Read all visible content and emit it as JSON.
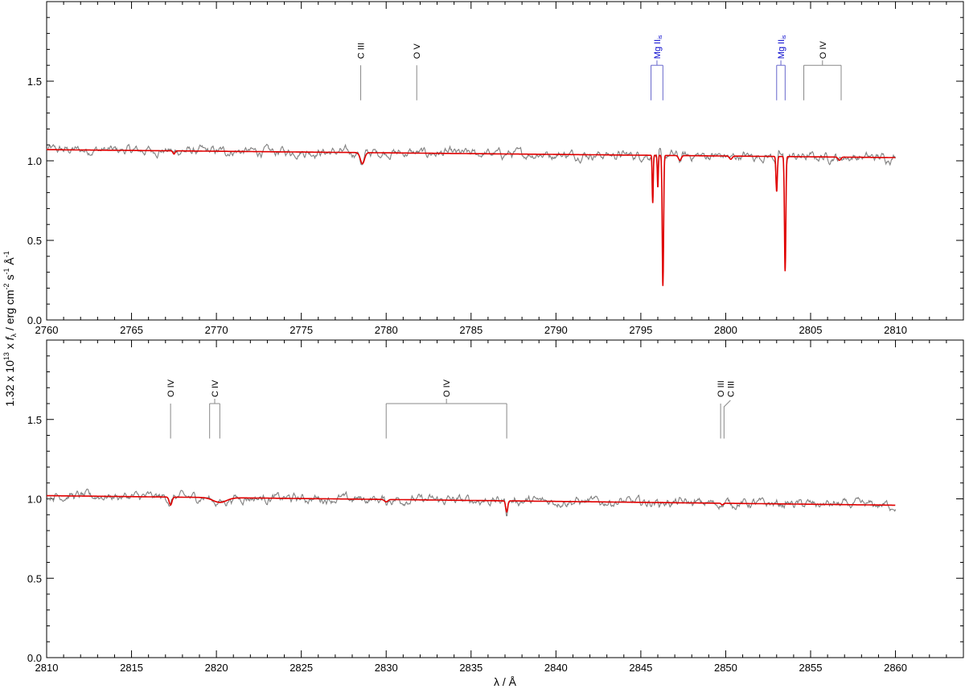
{
  "figure": {
    "ylabel_parts": {
      "prefix": "1.32 x 10",
      "exp": "13",
      "x": " x ",
      "f": "f",
      "lambda_sub": "λ",
      "mid": " / erg cm",
      "cm_exp": "-2",
      "s": " s",
      "s_exp": "-1",
      "A": " Å",
      "A_exp": "-1"
    },
    "xlabel": "λ / Å"
  },
  "chart_data": [
    {
      "type": "line",
      "name": "panel-top",
      "title": "",
      "xlim": [
        2760,
        2814
      ],
      "ylim": [
        0.0,
        2.0
      ],
      "xticks": [
        2760,
        2765,
        2770,
        2775,
        2780,
        2785,
        2790,
        2795,
        2800,
        2805,
        2810
      ],
      "yticks": [
        0.0,
        0.5,
        1.0,
        1.5
      ],
      "ytick_labels": [
        "0.0",
        "0.5",
        "1.0",
        "1.5"
      ],
      "grid": false,
      "observed_baseline": [
        [
          2760,
          1.07
        ],
        [
          2810,
          1.02
        ]
      ],
      "model_continuum": [
        [
          2760,
          1.07
        ],
        [
          2810,
          1.02
        ]
      ],
      "model_absorptions": [
        {
          "x": 2767.5,
          "depth": 0.02,
          "width": 0.06
        },
        {
          "x": 2778.6,
          "depth": 0.07,
          "width": 0.12
        },
        {
          "x": 2795.7,
          "depth": 0.3,
          "width": 0.03
        },
        {
          "x": 2796.0,
          "depth": 0.2,
          "width": 0.03
        },
        {
          "x": 2796.3,
          "depth": 0.82,
          "width": 0.04
        },
        {
          "x": 2797.3,
          "depth": 0.03,
          "width": 0.08
        },
        {
          "x": 2800.3,
          "depth": 0.02,
          "width": 0.08
        },
        {
          "x": 2803.0,
          "depth": 0.22,
          "width": 0.04
        },
        {
          "x": 2803.5,
          "depth": 0.72,
          "width": 0.04
        },
        {
          "x": 2806.7,
          "depth": 0.02,
          "width": 0.08
        }
      ],
      "line_ids": [
        {
          "label": "C III",
          "x": [
            2778.5
          ],
          "color": "#000000"
        },
        {
          "label": "O V",
          "x": [
            2781.8
          ],
          "color": "#000000"
        },
        {
          "label": "Mg II",
          "sub": "is",
          "x": [
            2795.6,
            2796.3
          ],
          "color": "#0000cc"
        },
        {
          "label": "Mg II",
          "sub": "is",
          "x": [
            2803.0,
            2803.5
          ],
          "color": "#0000cc"
        },
        {
          "label": "O IV",
          "x": [
            2804.6,
            2806.8
          ],
          "color": "#000000"
        }
      ],
      "series": [
        {
          "name": "",
          "color": "#808080"
        },
        {
          "name": "",
          "color": "#e00000"
        }
      ]
    },
    {
      "type": "line",
      "name": "panel-bottom",
      "title": "",
      "xlim": [
        2810,
        2864
      ],
      "ylim": [
        0.0,
        2.0
      ],
      "xticks": [
        2810,
        2815,
        2820,
        2825,
        2830,
        2835,
        2840,
        2845,
        2850,
        2855,
        2860
      ],
      "yticks": [
        0.0,
        0.5,
        1.0,
        1.5
      ],
      "ytick_labels": [
        "0.0",
        "0.5",
        "1.0",
        "1.5"
      ],
      "grid": false,
      "observed_baseline": [
        [
          2810,
          1.02
        ],
        [
          2860,
          0.96
        ]
      ],
      "model_continuum": [
        [
          2810,
          1.02
        ],
        [
          2860,
          0.96
        ]
      ],
      "model_absorptions": [
        {
          "x": 2817.3,
          "depth": 0.05,
          "width": 0.08
        },
        {
          "x": 2820.2,
          "depth": 0.03,
          "width": 0.4
        },
        {
          "x": 2830.0,
          "depth": 0.015,
          "width": 0.1
        },
        {
          "x": 2837.1,
          "depth": 0.07,
          "width": 0.06
        },
        {
          "x": 2849.8,
          "depth": 0.01,
          "width": 0.06
        }
      ],
      "line_ids": [
        {
          "label": "O IV",
          "x": [
            2817.3
          ],
          "color": "#000000"
        },
        {
          "label": "C IV",
          "x": [
            2819.6,
            2820.2
          ],
          "color": "#000000"
        },
        {
          "label": "O IV",
          "x": [
            2830.0,
            2837.1
          ],
          "color": "#000000"
        },
        {
          "label": "O III",
          "x": [
            2849.7
          ],
          "color": "#000000"
        },
        {
          "label": "C III",
          "x": [
            2849.9
          ],
          "color": "#000000",
          "offset": true
        }
      ],
      "series": [
        {
          "name": "",
          "color": "#808080"
        },
        {
          "name": "",
          "color": "#e00000"
        }
      ]
    }
  ]
}
